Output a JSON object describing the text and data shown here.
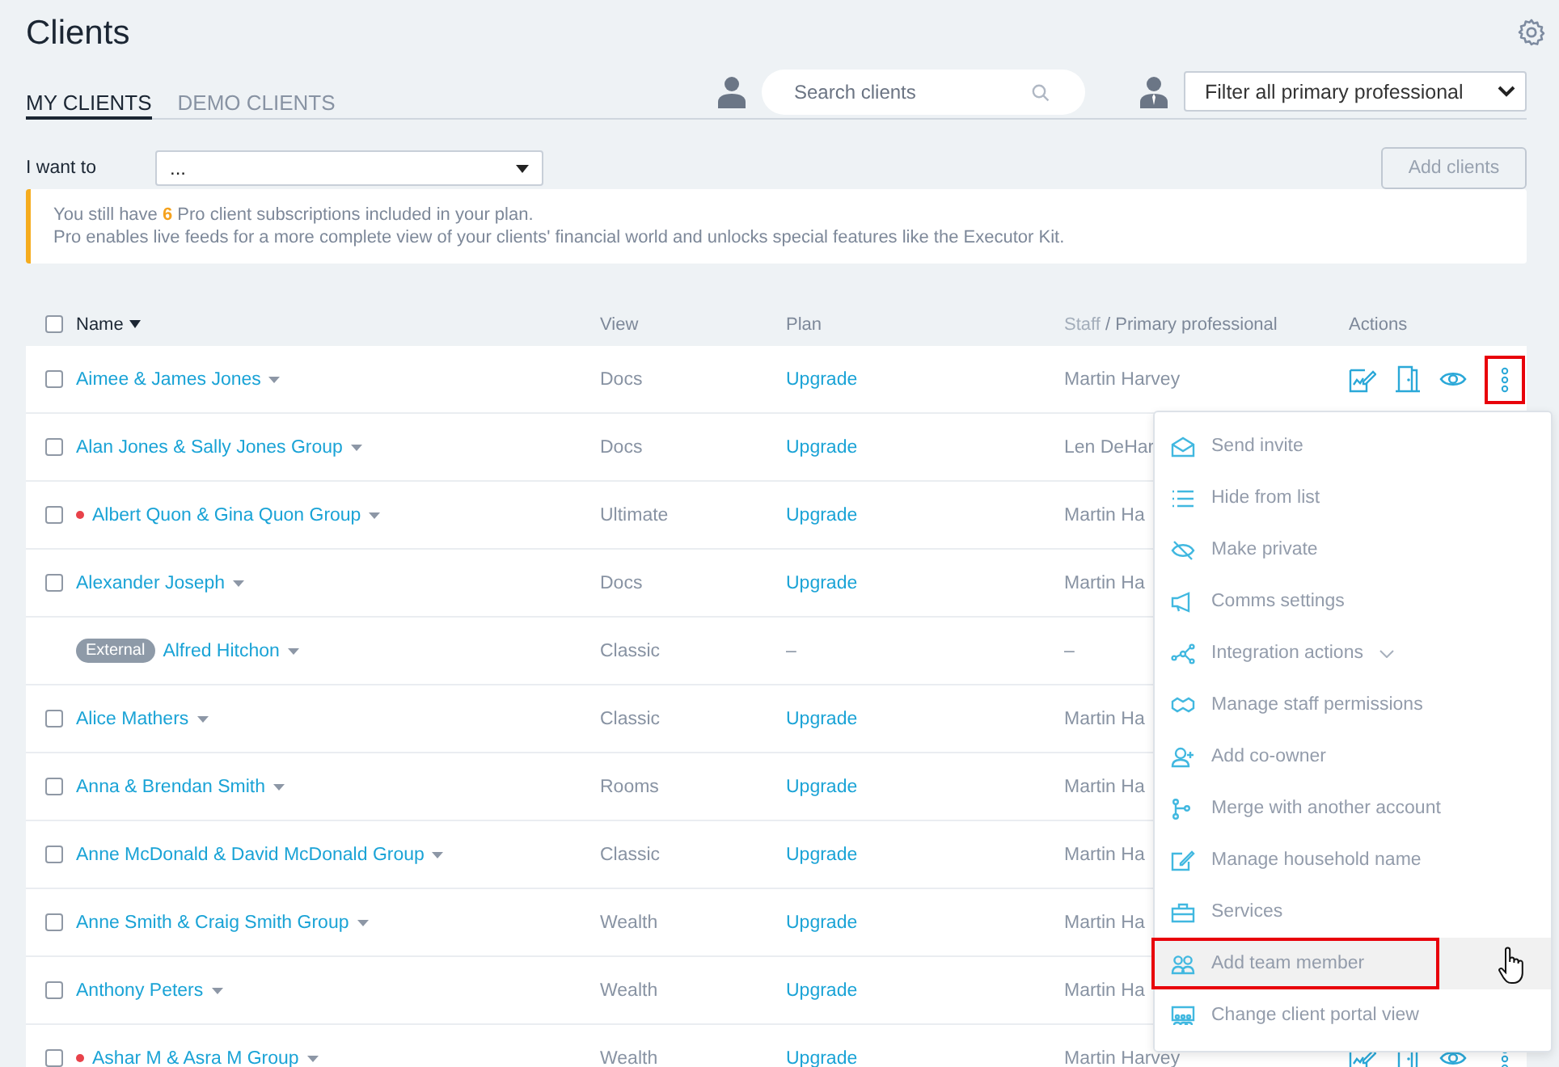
{
  "page": {
    "title": "Clients"
  },
  "tabs": [
    {
      "label": "MY CLIENTS",
      "selected": true
    },
    {
      "label": "DEMO CLIENTS",
      "selected": false
    }
  ],
  "search": {
    "placeholder": "Search clients"
  },
  "filter": {
    "value": "Filter all primary professional"
  },
  "action_bar": {
    "label": "I want to",
    "value": "...",
    "button": "Add clients"
  },
  "banner": {
    "lines": [
      "You still have **6** Pro client subscriptions included in your plan.",
      "Pro enables live feeds for a more complete view of your clients' financial world and unlocks special features like the Executor Kit."
    ]
  },
  "table": {
    "select_all": {
      "checked": false
    },
    "columns": [
      {
        "label": "Name",
        "sorted": true
      },
      {
        "label": "View",
        "sorted": false
      },
      {
        "label": "Plan",
        "sorted": false
      },
      {
        "label": "Staff",
        "secondary": "/ Primary professional",
        "sorted": false
      },
      {
        "label": "Actions",
        "sorted": false
      }
    ],
    "rows": [
      {
        "name": "Aimee & James Jones",
        "checkbox": false,
        "flagged": false,
        "view": "Docs",
        "plan": "Upgrade",
        "staff": "Martin Harvey",
        "actions_visible": true,
        "menu_open": true
      },
      {
        "name": "Alan Jones & Sally Jones Group",
        "checkbox": false,
        "flagged": false,
        "view": "Docs",
        "plan": "Upgrade",
        "staff": "Len DeHar",
        "actions_visible": false,
        "menu_open": false
      },
      {
        "name": "Albert Quon & Gina Quon Group",
        "checkbox": false,
        "flagged": true,
        "view": "Ultimate",
        "plan": "Upgrade",
        "staff": "Martin Ha",
        "actions_visible": false,
        "menu_open": false
      },
      {
        "name": "Alexander Joseph",
        "checkbox": false,
        "flagged": false,
        "view": "Docs",
        "plan": "Upgrade",
        "staff": "Martin Ha",
        "actions_visible": false,
        "menu_open": false
      },
      {
        "name": "Alfred Hitchon",
        "flagged": false,
        "badge": "External",
        "view": "Classic",
        "plan": "–",
        "staff": "–",
        "actions_visible": false,
        "menu_open": false
      },
      {
        "name": "Alice Mathers",
        "checkbox": false,
        "flagged": false,
        "view": "Classic",
        "plan": "Upgrade",
        "staff": "Martin Ha",
        "actions_visible": false,
        "menu_open": false
      },
      {
        "name": "Anna & Brendan Smith",
        "checkbox": false,
        "flagged": false,
        "view": "Rooms",
        "plan": "Upgrade",
        "staff": "Martin Ha",
        "actions_visible": false,
        "menu_open": false
      },
      {
        "name": "Anne McDonald & David McDonald Group",
        "checkbox": false,
        "flagged": false,
        "view": "Classic",
        "plan": "Upgrade",
        "staff": "Martin Ha",
        "actions_visible": false,
        "menu_open": false
      },
      {
        "name": "Anne Smith & Craig Smith Group",
        "checkbox": false,
        "flagged": false,
        "view": "Wealth",
        "plan": "Upgrade",
        "staff": "Martin Ha",
        "actions_visible": false,
        "menu_open": false
      },
      {
        "name": "Anthony Peters",
        "checkbox": false,
        "flagged": false,
        "view": "Wealth",
        "plan": "Upgrade",
        "staff": "Martin Ha",
        "actions_visible": false,
        "menu_open": false
      },
      {
        "name": "Ashar M & Asra M Group",
        "checkbox": false,
        "flagged": true,
        "view": "Wealth",
        "plan": "Upgrade",
        "staff": "Martin Harvey",
        "actions_visible": true,
        "menu_open": false
      }
    ]
  },
  "menu": {
    "items": [
      {
        "label": "Send invite",
        "has_submenu": false,
        "selected": false
      },
      {
        "label": "Hide from list",
        "has_submenu": false,
        "selected": false
      },
      {
        "label": "Make private",
        "has_submenu": false,
        "selected": false
      },
      {
        "label": "Comms settings",
        "has_submenu": false,
        "selected": false
      },
      {
        "label": "Integration actions",
        "has_submenu": true,
        "selected": false
      },
      {
        "label": "Manage staff permissions",
        "has_submenu": false,
        "selected": false
      },
      {
        "label": "Add co-owner",
        "has_submenu": false,
        "selected": false
      },
      {
        "label": "Merge with another account",
        "has_submenu": false,
        "selected": false
      },
      {
        "label": "Manage household name",
        "has_submenu": false,
        "selected": false
      },
      {
        "label": "Services",
        "has_submenu": false,
        "selected": false
      },
      {
        "label": "Add team member",
        "has_submenu": false,
        "selected": true
      },
      {
        "label": "Change client portal view",
        "has_submenu": false,
        "selected": false
      }
    ]
  }
}
